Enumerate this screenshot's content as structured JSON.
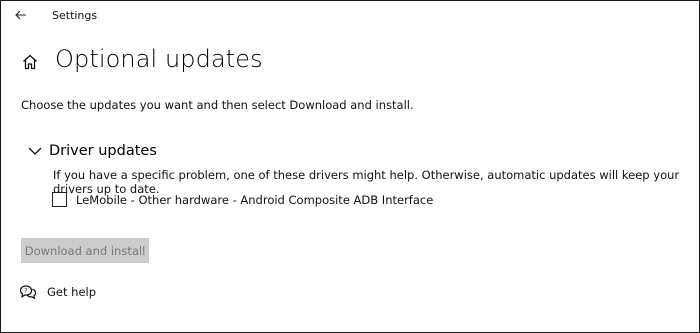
{
  "window": {
    "title": "Settings"
  },
  "page": {
    "title": "Optional updates",
    "description": "Choose the updates you want and then select Download and install."
  },
  "driver_section": {
    "title": "Driver updates",
    "expanded": true,
    "description": "If you have a specific problem, one of these drivers might help. Otherwise, automatic updates will keep your drivers up to date.",
    "items": [
      {
        "label": "LeMobile - Other hardware - Android Composite ADB Interface",
        "checked": false
      }
    ]
  },
  "actions": {
    "download_label": "Download and install",
    "download_enabled": false
  },
  "help": {
    "label": "Get help"
  },
  "icons": {
    "back": "back-arrow-icon",
    "home": "home-icon",
    "chevron": "chevron-down-icon",
    "help": "help-chat-icon"
  },
  "colors": {
    "button_disabled_bg": "#cccccc",
    "button_disabled_text": "#7a7a7a",
    "border": "#1a1a1a"
  }
}
